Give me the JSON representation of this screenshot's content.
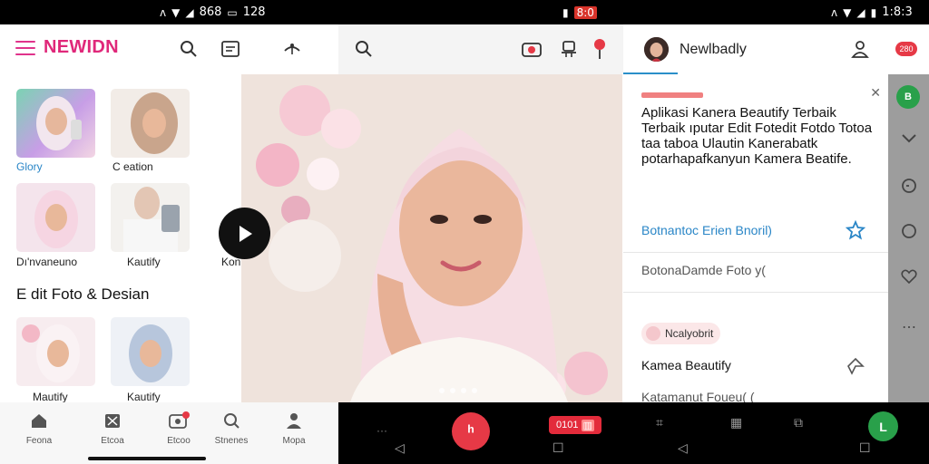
{
  "status_bar": {
    "left_time": "128",
    "left_other": "868",
    "mid_badge": "8:0",
    "right_time": "1:8:3"
  },
  "app": {
    "brand": "NEWIDN",
    "tiles": [
      {
        "caption": "Glory"
      },
      {
        "caption": "C eation"
      },
      {
        "caption": "Dı'nvaneuno"
      },
      {
        "caption": "Kautify"
      },
      {
        "caption": "Kon"
      },
      {
        "caption": "Mautify"
      },
      {
        "caption": "Kautify"
      }
    ],
    "section_title": "E dit Foto & Desian",
    "bottom_nav": [
      {
        "label": "Feona",
        "icon": "home-icon"
      },
      {
        "label": "Etcoa",
        "icon": "edit-icon"
      },
      {
        "label": "Etcoo",
        "icon": "camera-icon"
      },
      {
        "label": "Stnenes",
        "icon": "search-icon"
      },
      {
        "label": "Mopa",
        "icon": "profile-icon"
      }
    ]
  },
  "right_panel": {
    "username": "Newlbadly",
    "badge": "280",
    "card": {
      "title": "Aplikasi Kanera Beautify Terbaik Terbaik ıputar Edit Fotedit Fotdo Totoa taa taboa Ulautin Kanerabatk potarhapafkanyun Kamera Beatife.",
      "link": "Botnantoc Erien Bnoril)",
      "item1": "BotonaDamde Foto y(",
      "chip": "Ncalyobrit",
      "item2": "Kamea Beautify",
      "item3": "Katamanut Foueu( ( "
    }
  },
  "bottom_bar": {
    "rec_label": "0101",
    "accent_red": "#e63946",
    "accent_green": "#29a04a"
  },
  "colors": {
    "brand": "#e0287a",
    "link": "#2a86c7"
  }
}
